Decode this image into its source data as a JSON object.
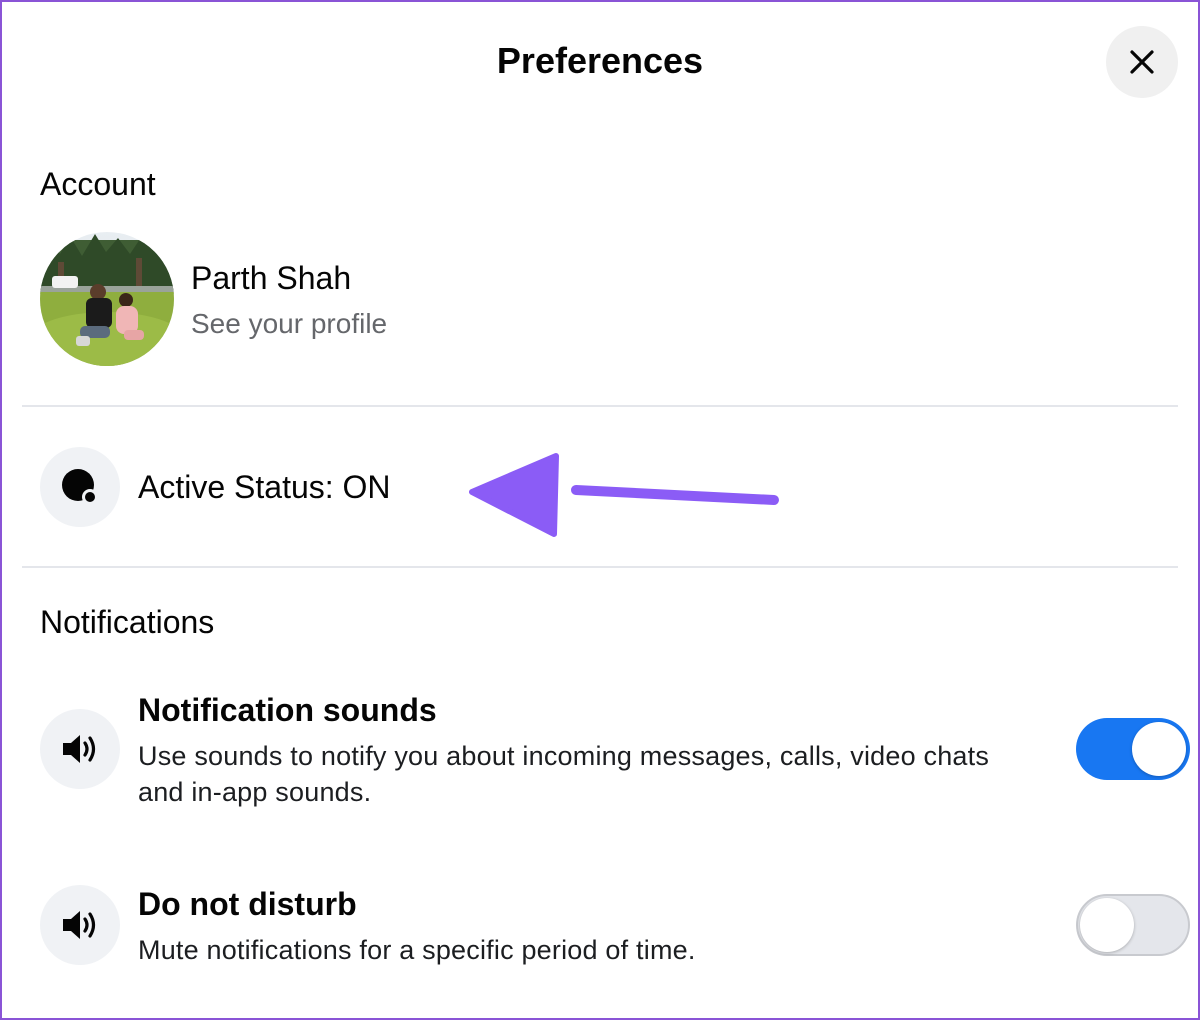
{
  "header": {
    "title": "Preferences",
    "close_icon": "close-icon"
  },
  "account": {
    "heading": "Account",
    "name": "Parth Shah",
    "link": "See your profile"
  },
  "active_status": {
    "label": "Active Status: ON",
    "icon": "active-status-icon"
  },
  "notifications": {
    "heading": "Notifications",
    "items": [
      {
        "title": "Notification sounds",
        "description": "Use sounds to notify you about incoming messages, calls, video chats and in-app sounds.",
        "icon": "speaker-icon",
        "enabled": true
      },
      {
        "title": "Do not disturb",
        "description": "Mute notifications for a specific period of time.",
        "icon": "speaker-icon",
        "enabled": false
      }
    ]
  },
  "colors": {
    "toggle_on": "#1877f2",
    "toggle_off": "#e4e6eb",
    "annotation_arrow": "#8b5cf6"
  }
}
